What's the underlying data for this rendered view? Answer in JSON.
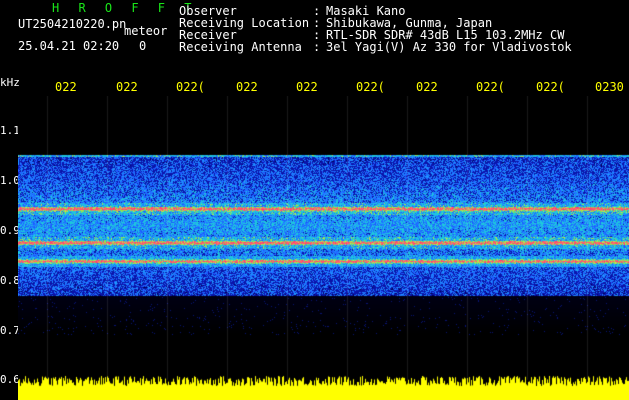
{
  "header": {
    "app_title": "H R O F F T",
    "filename": "UT2504210220.pn",
    "meteor_label": "meteor",
    "datetime": "25.04.21 02:20",
    "meteor_count": "0"
  },
  "info": [
    {
      "label": "Observer",
      "value": "Masaki Kano"
    },
    {
      "label": "Receiving Location",
      "value": "Shibukawa, Gunma, Japan"
    },
    {
      "label": "Receiver",
      "value": "RTL-SDR SDR# 43dB L15 103.2MHz CW"
    },
    {
      "label": "Receiving Antenna",
      "value": "3el Yagi(V) Az 330 for Vladivostok"
    }
  ],
  "time_axis": {
    "labels": [
      "022",
      "022",
      "022(",
      "022",
      "022",
      "022(",
      "022",
      "022(",
      "022(",
      "0230"
    ]
  },
  "freq_axis": {
    "unit": "kHz",
    "labels": [
      "1.1",
      "1.0",
      "0.9",
      "0.8",
      "0.7",
      "0.6"
    ],
    "range": [
      0.58,
      1.2
    ]
  },
  "spectrogram": {
    "band_khz": [
      0.77,
      1.05
    ],
    "lines_khz": [
      0.943,
      0.875,
      0.838
    ],
    "colors": {
      "background": "#000000",
      "noise": "#1e3cff",
      "signal": "#ff3c6e",
      "amplitude_trace": "#ffff00"
    }
  }
}
